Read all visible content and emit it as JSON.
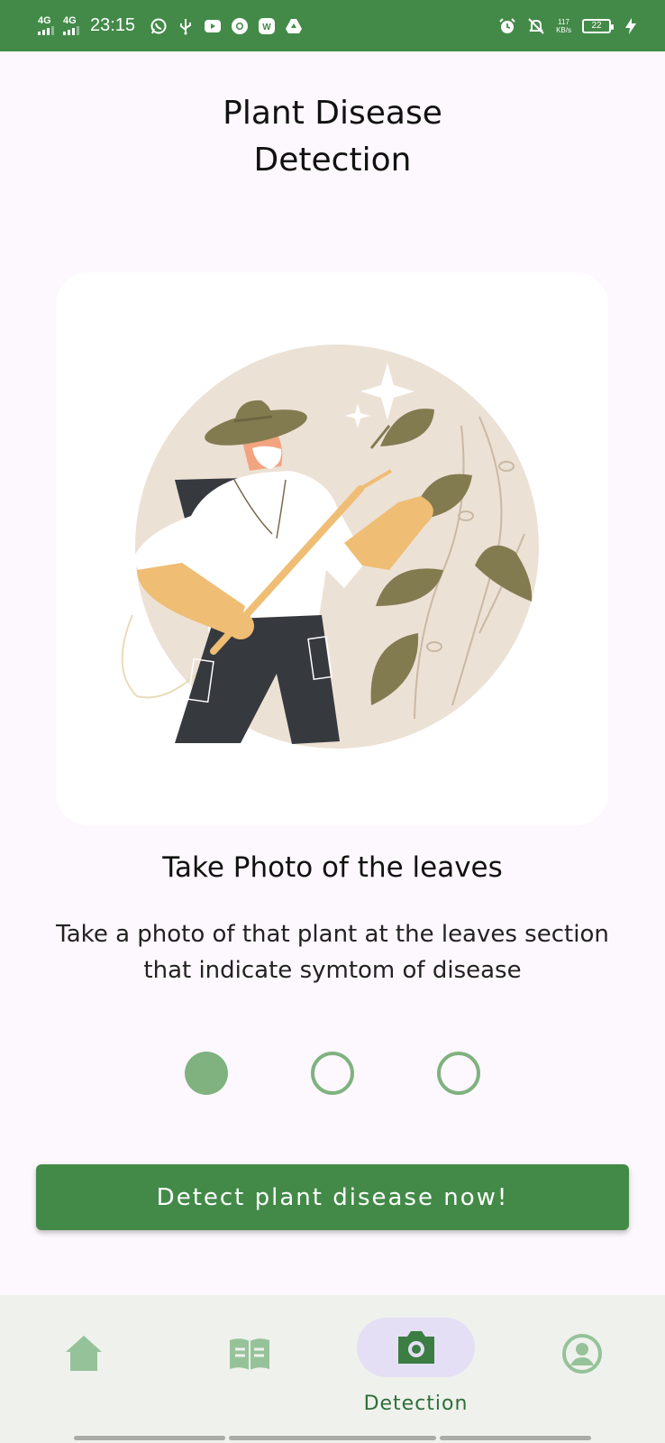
{
  "status_bar": {
    "network1": "4G",
    "network2": "4G",
    "time": "23:15",
    "speed_value": "117",
    "speed_unit": "KB/s",
    "battery": "22",
    "icons": [
      "whatsapp-icon",
      "usb-icon",
      "youtube-icon",
      "chrome-icon",
      "app-icon",
      "drive-icon",
      "alarm-icon",
      "notifications-off-icon",
      "charging-icon"
    ]
  },
  "page": {
    "title": "Plant Disease\nDetection",
    "step_title": "Take Photo of the leaves",
    "step_description": "Take a photo of that plant at the leaves section that indicate symtom of disease",
    "illustration": "farmer-spraying-plant-illustration",
    "pager": {
      "total": 3,
      "current": 1
    },
    "detect_button": "Detect plant disease now!"
  },
  "bottom_nav": {
    "items": [
      {
        "icon": "home-icon",
        "label": "",
        "selected": false
      },
      {
        "icon": "book-icon",
        "label": "",
        "selected": false
      },
      {
        "icon": "camera-icon",
        "label": "Detection",
        "selected": true
      },
      {
        "icon": "account-icon",
        "label": "",
        "selected": false
      }
    ]
  },
  "colors": {
    "primary": "#438a48",
    "dot": "#7fb27f",
    "nav_pill": "#e4dff5",
    "nav_bg": "#eff1ec",
    "background": "#fdf8fd"
  }
}
